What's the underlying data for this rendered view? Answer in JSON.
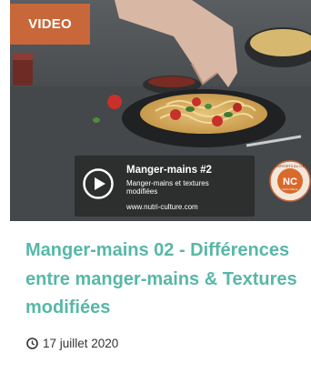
{
  "badge": {
    "label": "VIDEO"
  },
  "video": {
    "title": "Manger-mains #2",
    "subtitle": "Manger-mains et textures modifiées",
    "url": "www.nutri-culture.com"
  },
  "logo": {
    "initials": "NC",
    "ring_text": "LES APPORTS DU CŒUR",
    "caption": "Nutri-Culture"
  },
  "post": {
    "title": "Manger-mains 02 - Différences entre manger-mains & Textures modifiées",
    "date": "17 juillet 2020"
  },
  "icons": {
    "play": "play-icon",
    "date": "clock-icon"
  },
  "colors": {
    "badge": "#c7673a",
    "title": "#58b7a8",
    "logo_bg": "#d86a2c",
    "logo_ring": "#c7673a"
  }
}
